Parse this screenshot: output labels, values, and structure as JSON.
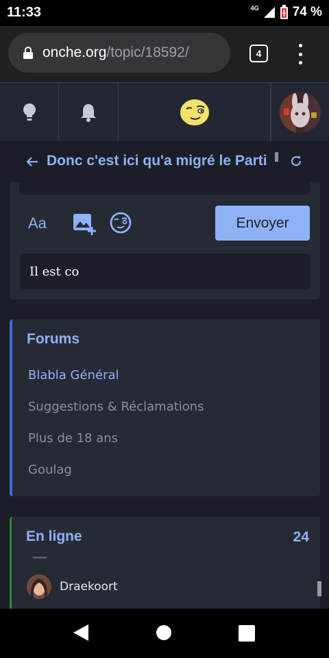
{
  "status_bar": {
    "time": "11:33",
    "network": "4G",
    "battery": "74 %"
  },
  "browser": {
    "domain": "onche.org",
    "path": "/topic/18592/",
    "tab_count": "4"
  },
  "nav": {
    "icons": [
      "lightbulb-icon",
      "bell-icon",
      "smiley-logo",
      "avatar"
    ]
  },
  "topic": {
    "title": "Donc c'est ici qu'a migré le Parti"
  },
  "editor": {
    "font_button": "Aa",
    "send_label": "Envoyer",
    "input_value": "Il est co"
  },
  "forums": {
    "title": "Forums",
    "items": [
      {
        "label": "Blabla Général",
        "active": true
      },
      {
        "label": "Suggestions & Réclamations",
        "active": false
      },
      {
        "label": "Plus de 18 ans",
        "active": false
      },
      {
        "label": "Goulag",
        "active": false
      }
    ]
  },
  "online": {
    "title": "En ligne",
    "count": "24",
    "users": [
      {
        "name": "Draekoort"
      }
    ]
  },
  "colors": {
    "accent": "#8fb2f7",
    "card_bg": "#262a35",
    "page_bg": "#1b1e26",
    "forums_border": "#3a6fd8",
    "online_border": "#2f8a3a"
  }
}
